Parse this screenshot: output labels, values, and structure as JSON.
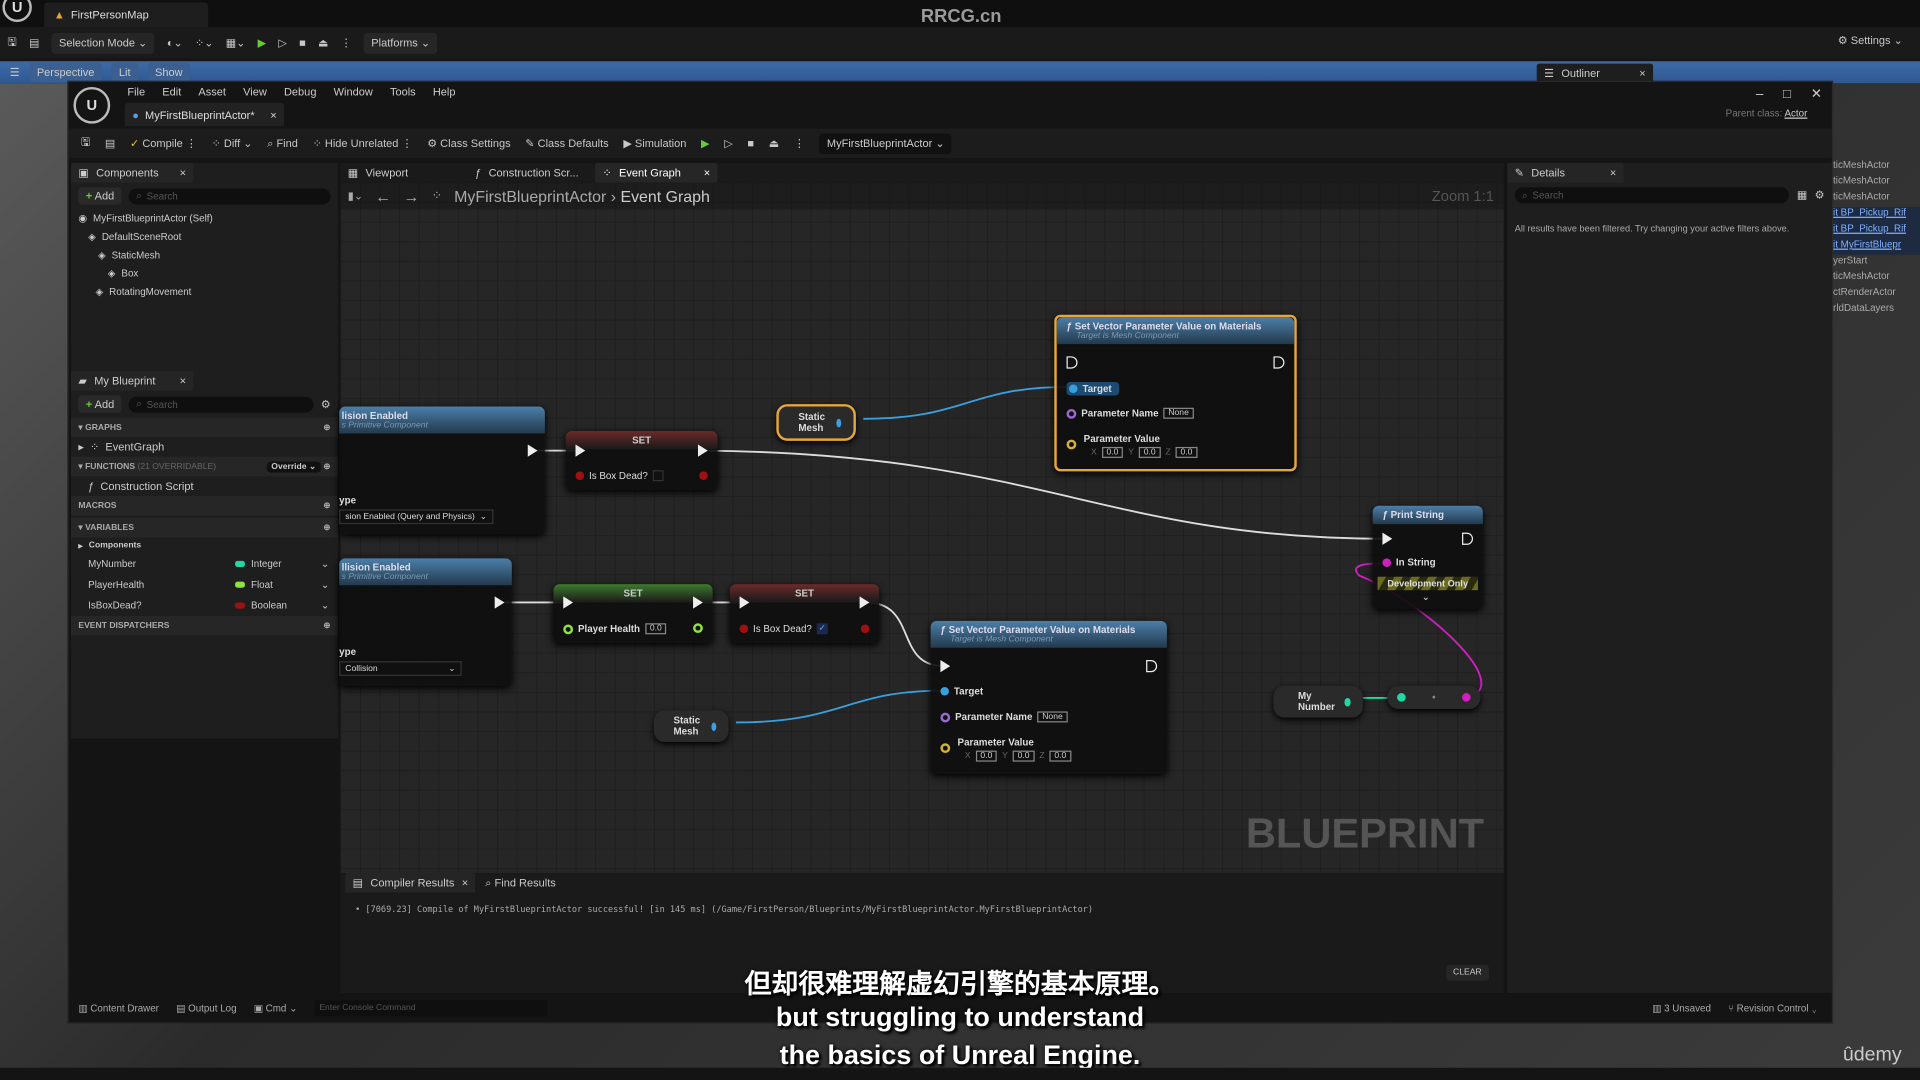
{
  "topbar": {
    "map_tab": "FirstPersonMap",
    "watermark": "RRCG.cn",
    "settings": "Settings"
  },
  "main_toolbar": {
    "selection_mode": "Selection Mode",
    "platforms": "Platforms"
  },
  "viewport": {
    "perspective": "Perspective",
    "lit": "Lit",
    "show": "Show"
  },
  "outliner": {
    "tab": "Outliner",
    "items": [
      "ticMeshActor",
      "ticMeshActor",
      "ticMeshActor",
      "it BP_Pickup_Rif",
      "it BP_Pickup_Rif",
      "it MyFirstBluepr",
      "yerStart",
      "ticMeshActor",
      "ctRenderActor",
      "rldDataLayers"
    ],
    "selected": [
      3,
      4,
      5
    ]
  },
  "editor": {
    "menu": [
      "File",
      "Edit",
      "Asset",
      "View",
      "Debug",
      "Window",
      "Tools",
      "Help"
    ],
    "tab": "MyFirstBlueprintActor*",
    "parent_class_label": "Parent class:",
    "parent_class": "Actor",
    "toolbar": {
      "compile": "Compile",
      "diff": "Diff",
      "find": "Find",
      "hide_unrelated": "Hide Unrelated",
      "class_settings": "Class Settings",
      "class_defaults": "Class Defaults",
      "simulation": "Simulation",
      "debug_object": "MyFirstBlueprintActor"
    },
    "components": {
      "tab": "Components",
      "add": "Add",
      "search_placeholder": "Search",
      "tree": [
        "MyFirstBlueprintActor (Self)",
        "DefaultSceneRoot",
        "StaticMesh",
        "Box",
        "RotatingMovement"
      ]
    },
    "my_blueprint": {
      "tab": "My Blueprint",
      "add": "Add",
      "search_placeholder": "Search",
      "graphs": "GRAPHS",
      "event_graph": "EventGraph",
      "functions": "FUNCTIONS",
      "functions_count": "(21 OVERRIDABLE)",
      "override": "Override",
      "construction_script": "Construction Script",
      "macros": "MACROS",
      "variables": "VARIABLES",
      "components_cat": "Components",
      "vars": [
        {
          "name": "MyNumber",
          "type": "Integer",
          "color": "#1fd9a4"
        },
        {
          "name": "PlayerHealth",
          "type": "Float",
          "color": "#8ee33c"
        },
        {
          "name": "IsBoxDead?",
          "type": "Boolean",
          "color": "#a01010"
        }
      ],
      "event_dispatchers": "EVENT DISPATCHERS"
    },
    "graph_tabs": [
      "Viewport",
      "Construction Scr...",
      "Event Graph"
    ],
    "breadcrumb": {
      "root": "MyFirstBlueprintActor",
      "current": "Event Graph"
    },
    "zoom": "Zoom 1:1",
    "watermark": "BLUEPRINT",
    "nodes": {
      "collision1": {
        "title": "lision Enabled",
        "sub": "s Primitive Component",
        "type_label": "ype",
        "type_value": "sion Enabled (Query and Physics)"
      },
      "collision2": {
        "title": "llision Enabled",
        "sub": "s Primitive Component",
        "type_label": "ype",
        "type_value": "Collision"
      },
      "set1": {
        "title": "SET",
        "pin": "Is Box Dead?",
        "checked": false
      },
      "set2": {
        "title": "SET",
        "pin": "Player Health",
        "value": "0.0"
      },
      "set3": {
        "title": "SET",
        "pin": "Is Box Dead?",
        "checked": true
      },
      "static_mesh1": "Static Mesh",
      "static_mesh2": "Static Mesh",
      "svp1": {
        "title": "Set Vector Parameter Value on Materials",
        "sub": "Target is Mesh Component",
        "target": "Target",
        "param_name": "Parameter Name",
        "param_name_value": "None",
        "param_value": "Parameter Value",
        "x": "0.0",
        "y": "0.0",
        "z": "0.0"
      },
      "svp2": {
        "title": "Set Vector Parameter Value on Materials",
        "sub": "Target is Mesh Component",
        "target": "Target",
        "param_name": "Parameter Name",
        "param_name_value": "None",
        "param_value": "Parameter Value",
        "x": "0.0",
        "y": "0.0",
        "z": "0.0"
      },
      "print": {
        "title": "Print String",
        "in_string": "In String",
        "dev": "Development Only"
      },
      "my_number": "My Number"
    },
    "details": {
      "tab": "Details",
      "search_placeholder": "Search",
      "message": "All results have been filtered. Try changing your active filters above."
    },
    "results": {
      "tabs": [
        "Compiler Results",
        "Find Results"
      ],
      "log": "[7069.23] Compile of MyFirstBlueprintActor successful! [in 145 ms] (/Game/FirstPerson/Blueprints/MyFirstBlueprintActor.MyFirstBlueprintActor)",
      "clear": "CLEAR"
    },
    "statusbar": {
      "content_drawer": "Content Drawer",
      "output_log": "Output Log",
      "cmd": "Cmd",
      "console_placeholder": "Enter Console Command",
      "unsaved": "3 Unsaved",
      "revision": "Revision Control"
    }
  },
  "subtitles": {
    "zh": "但却很难理解虚幻引擎的基本原理。",
    "en1": "but struggling to understand",
    "en2": "the basics of Unreal Engine."
  },
  "brand": "ûdemy"
}
